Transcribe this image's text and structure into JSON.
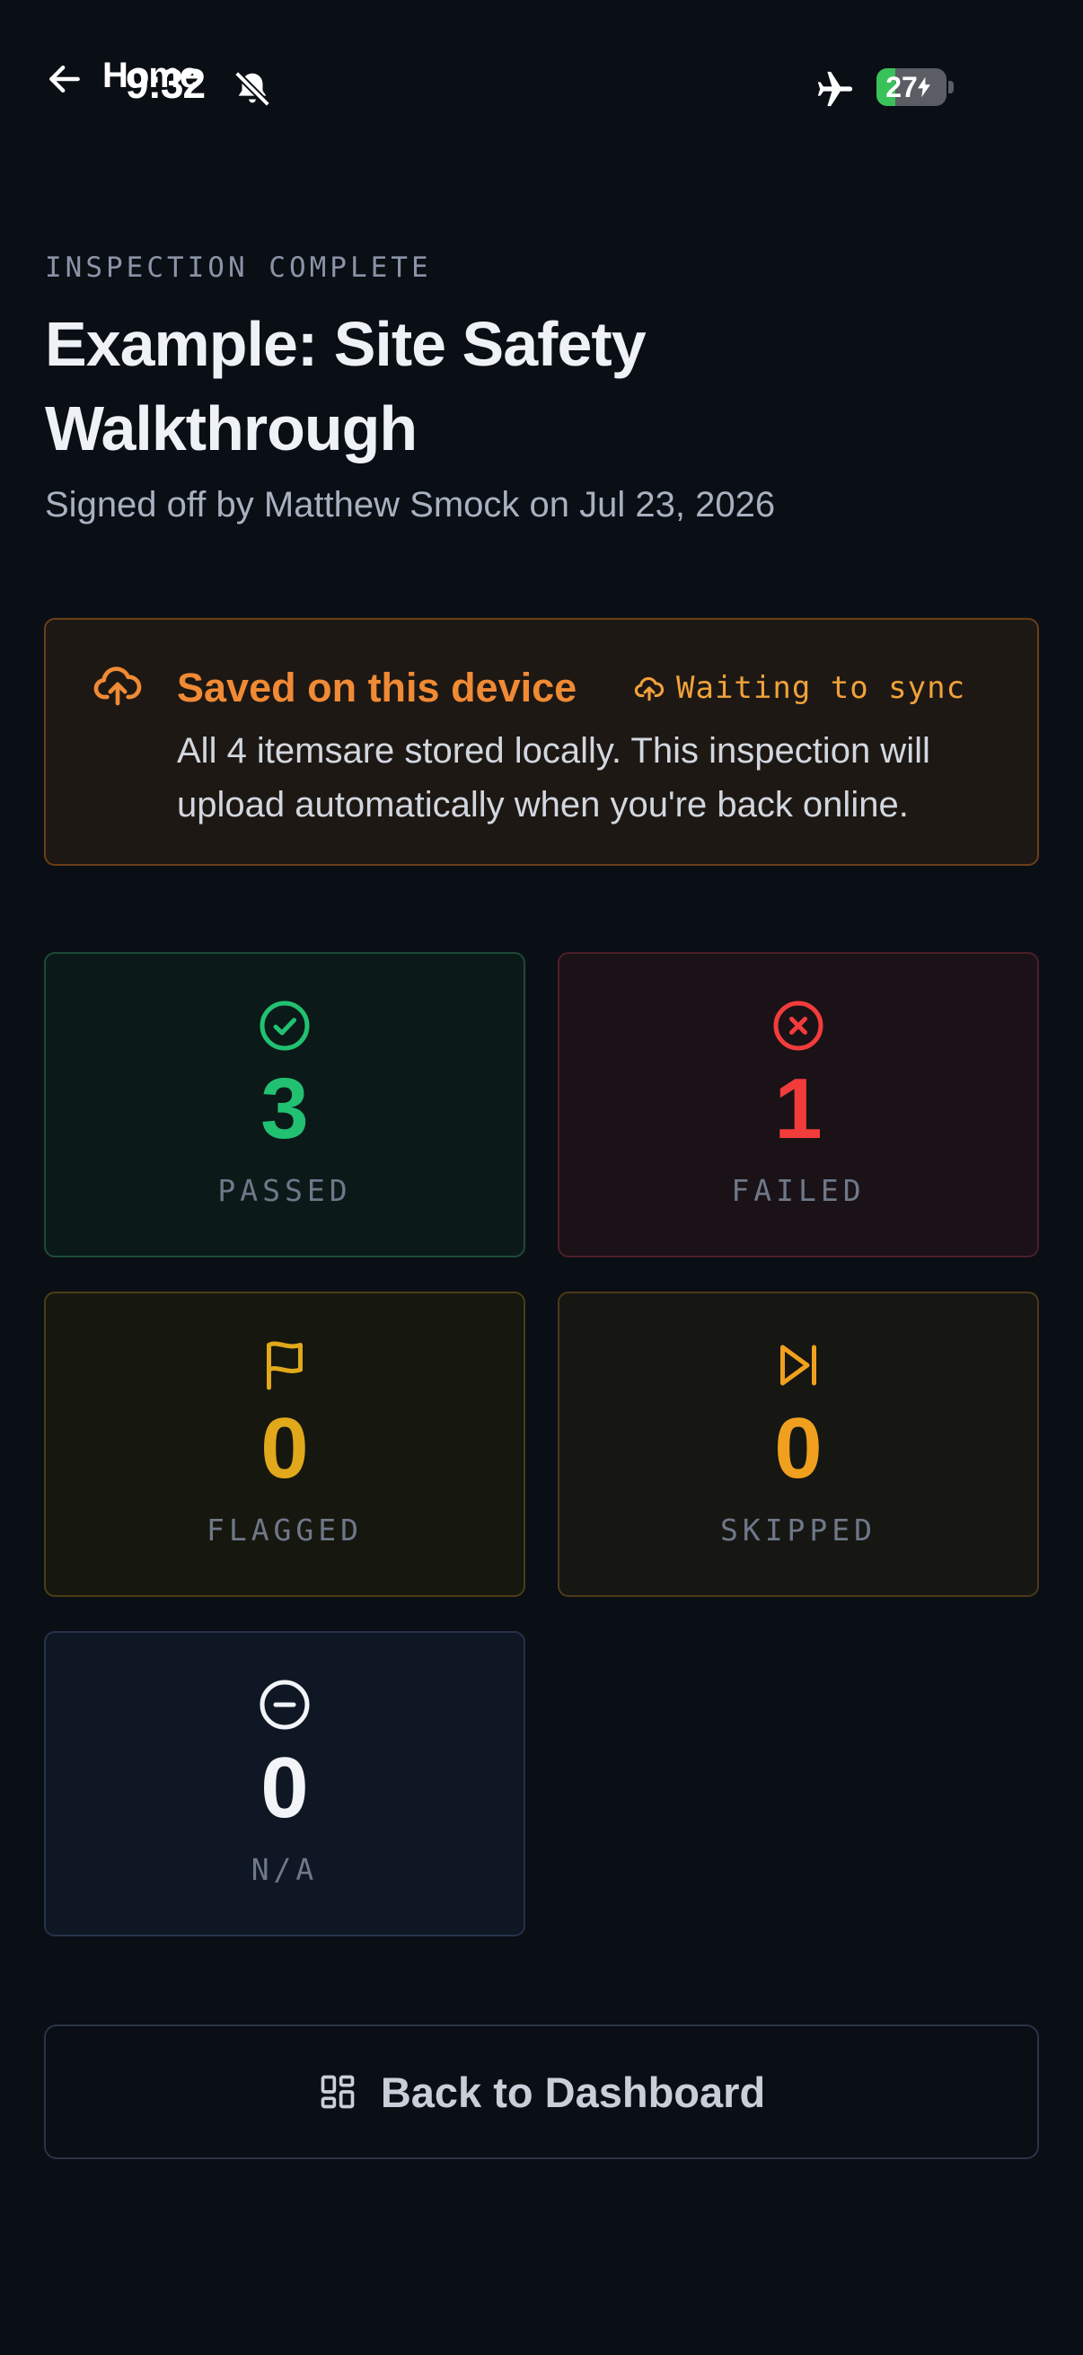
{
  "statusbar": {
    "nav_label": "Home",
    "time": "9:32",
    "battery_level": "27",
    "battery_percent": 27
  },
  "header": {
    "eyebrow": "INSPECTION COMPLETE",
    "title": "Example: Site Safety Walkthrough",
    "subtitle": "Signed off by Matthew Smock on Jul 23, 2026"
  },
  "banner": {
    "title": "Saved on this device",
    "status": "Waiting to sync",
    "body": "All 4 itemsare stored locally. This inspection will upload automatically when you're back online."
  },
  "stats": {
    "passed": {
      "value": "3",
      "label": "PASSED",
      "color": "#22c172"
    },
    "failed": {
      "value": "1",
      "label": "FAILED",
      "color": "#f23c3c"
    },
    "flagged": {
      "value": "0",
      "label": "FLAGGED",
      "color": "#e0a81a"
    },
    "skipped": {
      "value": "0",
      "label": "SKIPPED",
      "color": "#f0a01e"
    },
    "na": {
      "value": "0",
      "label": "N/A",
      "color": "#f2f4f8"
    }
  },
  "actions": {
    "back_to_dashboard": "Back to Dashboard"
  },
  "colors": {
    "background": "#0a0e15",
    "accent_orange": "#f08a34"
  }
}
